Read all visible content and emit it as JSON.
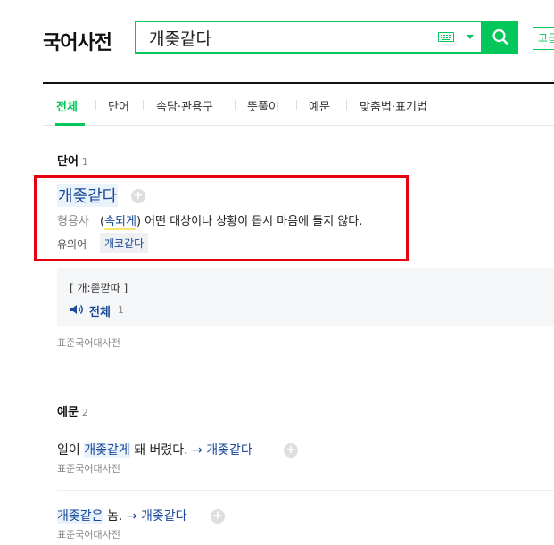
{
  "header": {
    "logo": "국어사전",
    "search_value": "개좆같다",
    "ime_label": "고급"
  },
  "tabs": [
    {
      "label": "전체",
      "active": true
    },
    {
      "label": "단어"
    },
    {
      "label": "속담·관용구"
    },
    {
      "label": "뜻풀이"
    },
    {
      "label": "예문"
    },
    {
      "label": "맞춤법·표기법"
    }
  ],
  "word_section": {
    "title": "단어",
    "count": "1",
    "entry": {
      "word": "개좆같다",
      "pos": "형용사",
      "def_open": "(",
      "def_link": "속되게",
      "def_rest": ") 어떤 대상이나 상황이 몹시 마음에 들지 않다.",
      "synonym_label": "유의어",
      "synonym": "개코같다",
      "pronunciation": "[ 개:졷깓따 ]",
      "pron_all": "전체",
      "pron_count": "1",
      "source": "표준국어대사전"
    }
  },
  "example_section": {
    "title": "예문",
    "count": "2",
    "examples": [
      {
        "pre": "일이 ",
        "hl": "개좆같게",
        "post": " 돼 버렸다. ",
        "link": "→ 개좆같다",
        "source": "표준국어대사전"
      },
      {
        "pre": "",
        "hl": "개좆같은",
        "post": " 놈. ",
        "link": "→ 개좆같다",
        "source": "표준국어대사전"
      }
    ]
  },
  "colors": {
    "accent": "#03c75a",
    "highlight_border": "#e60012",
    "link": "#1a4a9a"
  }
}
